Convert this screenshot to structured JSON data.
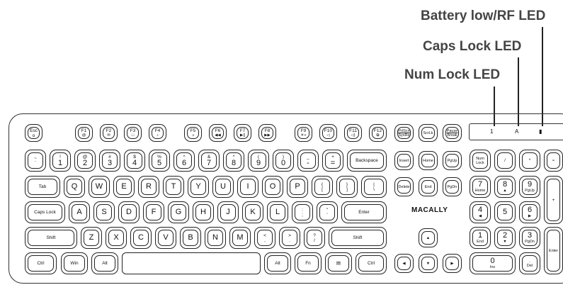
{
  "callouts": {
    "battery": "Battery low/RF  LED",
    "caps": "Caps Lock LED",
    "num": "Num Lock LED"
  },
  "brand": "MACALLY",
  "leds": [
    "1",
    "A",
    "▮"
  ],
  "keys": {
    "esc": "Esc",
    "esc_icon": "o",
    "f1": "F1",
    "f1_icon": "@",
    "f2": "F2",
    "f2_icon": "✉",
    "f3": "F3",
    "f3_icon": "□",
    "f4": "F4",
    "f4_icon": "♪",
    "f5": "F5",
    "f5_icon": "♫",
    "f6": "F6",
    "f6_icon": "◀◀",
    "f7": "F7",
    "f7_icon": "▶∥",
    "f8": "F8",
    "f8_icon": "▶▶",
    "f9": "F9",
    "f9_icon": "☀+",
    "f10": "F10",
    "f10_icon": "◁",
    "f11": "F11",
    "f11_icon": "◁)",
    "f12": "F12",
    "f12_icon": "⧉",
    "prtsc": "PrtScn",
    "sysrq": "SysRq",
    "scrlk": "ScrLk",
    "pause": "Pause",
    "break": "Break",
    "tilde_top": "~",
    "tilde_bot": "`",
    "n1_top": "!",
    "n1": "1",
    "n2_top": "@",
    "n2": "2",
    "n3_top": "#",
    "n3": "3",
    "n4_top": "$",
    "n4": "4",
    "n5_top": "%",
    "n5": "5",
    "n6_top": "^",
    "n6": "6",
    "n7_top": "&",
    "n7": "7",
    "n8_top": "*",
    "n8": "8",
    "n9_top": "(",
    "n9": "9",
    "n0_top": ")",
    "n0": "0",
    "minus_top": "_",
    "minus": "-",
    "plus_top": "+",
    "plus": "=",
    "backspace": "Backspace",
    "insert": "Insert",
    "home": "Home",
    "pgup": "PgUp",
    "numlock": "Num Lock",
    "div": "/",
    "mul": "*",
    "sub": "-",
    "tab": "Tab",
    "q": "Q",
    "w": "W",
    "e": "E",
    "r": "R",
    "t": "T",
    "y": "Y",
    "u": "U",
    "i": "I",
    "o": "O",
    "p": "P",
    "lbr_top": "{",
    "lbr": "[",
    "rbr_top": "}",
    "rbr": "]",
    "bs_top": "|",
    "bs": "\\",
    "delete": "Delete",
    "end": "End",
    "pgdn": "PgDn",
    "kp7": "7",
    "kp7_sub": "Home",
    "kp8": "8",
    "kp8_sub": "▲",
    "kp9": "9",
    "kp9_sub": "PgUp",
    "kpplus": "+",
    "caps": "Caps Lock",
    "a": "A",
    "s": "S",
    "d": "D",
    "f": "F",
    "g": "G",
    "h": "H",
    "j": "J",
    "k": "K",
    "l": "L",
    "semi_top": ":",
    "semi": ";",
    "quote_top": "\"",
    "quote": "'",
    "enter": "Enter",
    "kp4": "4",
    "kp4_sub": "◀",
    "kp5": "5",
    "kp6": "6",
    "kp6_sub": "▶",
    "shift": "Shift",
    "z": "Z",
    "x": "X",
    "c": "C",
    "v": "V",
    "b": "B",
    "n": "N",
    "m": "M",
    "comma_top": "<",
    "comma": ",",
    "period_top": ">",
    "period": ".",
    "slash_top": "?",
    "slash": "/",
    "rshift": "Shift",
    "up": "▲",
    "kp1": "1",
    "kp1_sub": "End",
    "kp2": "2",
    "kp2_sub": "▼",
    "kp3": "3",
    "kp3_sub": "PgDn",
    "kpenter": "Enter",
    "ctrl": "Ctrl",
    "win": "Win",
    "alt": "Alt",
    "ralt": "Alt",
    "fn": "Fn",
    "menu": "▤",
    "rctrl": "Ctrl",
    "left": "◀",
    "down": "▼",
    "right": "▶",
    "kp0": "0",
    "kp0_sub": "Ins",
    "kpdot": ".",
    "kpdot_sub": "Del"
  }
}
